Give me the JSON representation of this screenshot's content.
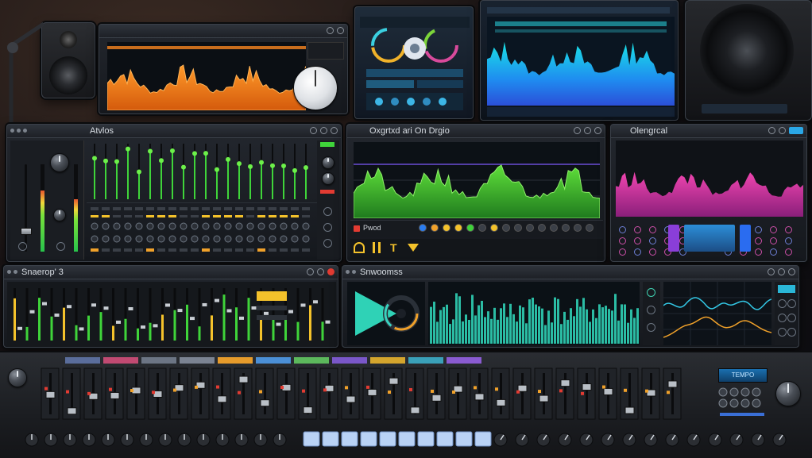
{
  "colors": {
    "orange": "#f7841f",
    "green": "#3fd43a",
    "magenta": "#d8328f",
    "cyan": "#33d9c4",
    "blue": "#2a7cf0",
    "accent_yellow": "#f4c22b",
    "accent_red": "#e23b32"
  },
  "panels": {
    "mixer": {
      "title": "Atvlos",
      "channel_count": 20,
      "icons": [
        "gear-icon",
        "minimize-icon",
        "close-icon"
      ]
    },
    "green_analyzer": {
      "title": "Oxgrtxd ari On Drgio",
      "transport_label": "Pwod"
    },
    "magenta_analyzer": {
      "title": "Olengrcal"
    },
    "bottom_mixer": {
      "title": "Snaerop' 3"
    },
    "visualizer": {
      "title": "Snwoomss"
    }
  },
  "controller": {
    "strip_colors": [
      "#5a6d9b",
      "#c14a72",
      "#6c7584",
      "#7b8392",
      "#e69b2b",
      "#4b8fd6",
      "#5cb85c",
      "#7a57c9",
      "#d4a52d",
      "#3aa0b8",
      "#8a5bd1"
    ],
    "pad_count": 10,
    "display_text": "TEMPO"
  }
}
